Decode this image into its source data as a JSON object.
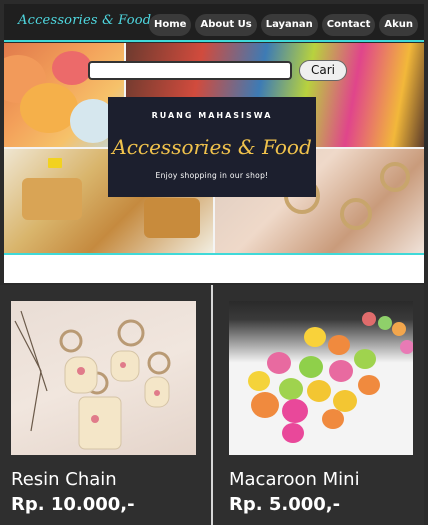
{
  "header": {
    "brand": "Accessories & Food",
    "menu": [
      "Home",
      "About Us",
      "Layanan",
      "Contact",
      "Akun"
    ]
  },
  "hero": {
    "search_placeholder": "",
    "search_button": "Cari",
    "banner": {
      "small_title": "RUANG MAHASISWA",
      "title": "Accessories & Food",
      "tagline": "Enjoy shopping in our shop!"
    }
  },
  "products": [
    {
      "name": "Resin Chain",
      "price": "Rp. 10.000,-"
    },
    {
      "name": "Macaroon Mini",
      "price": "Rp. 5.000,-"
    }
  ],
  "colors": {
    "accent": "#3fd9d9",
    "nav_bg": "#1f1f1f",
    "card_bg": "#2f2f2f",
    "banner_bg": "#1c1f2e",
    "banner_gold": "#f0c24c"
  }
}
